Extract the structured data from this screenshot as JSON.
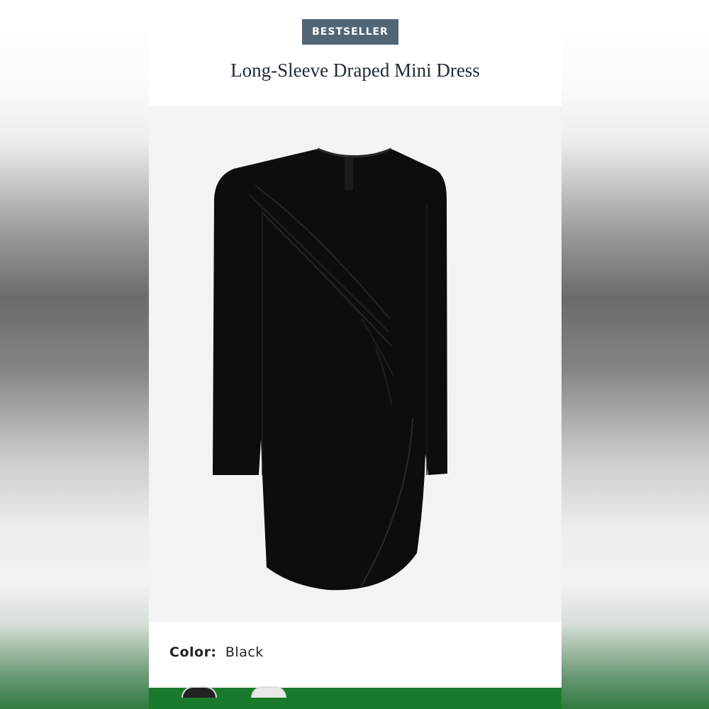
{
  "badge": {
    "label": "BESTSELLER"
  },
  "product": {
    "title": "Long-Sleeve Draped Mini Dress",
    "color_label": "Color:",
    "color_value": "Black",
    "image_alt": "black long-sleeve draped mini dress",
    "dress_color": "#0d0d0d"
  },
  "colors": {
    "badge_bg": "#516577",
    "bottom_bar": "#1a7a2c"
  }
}
